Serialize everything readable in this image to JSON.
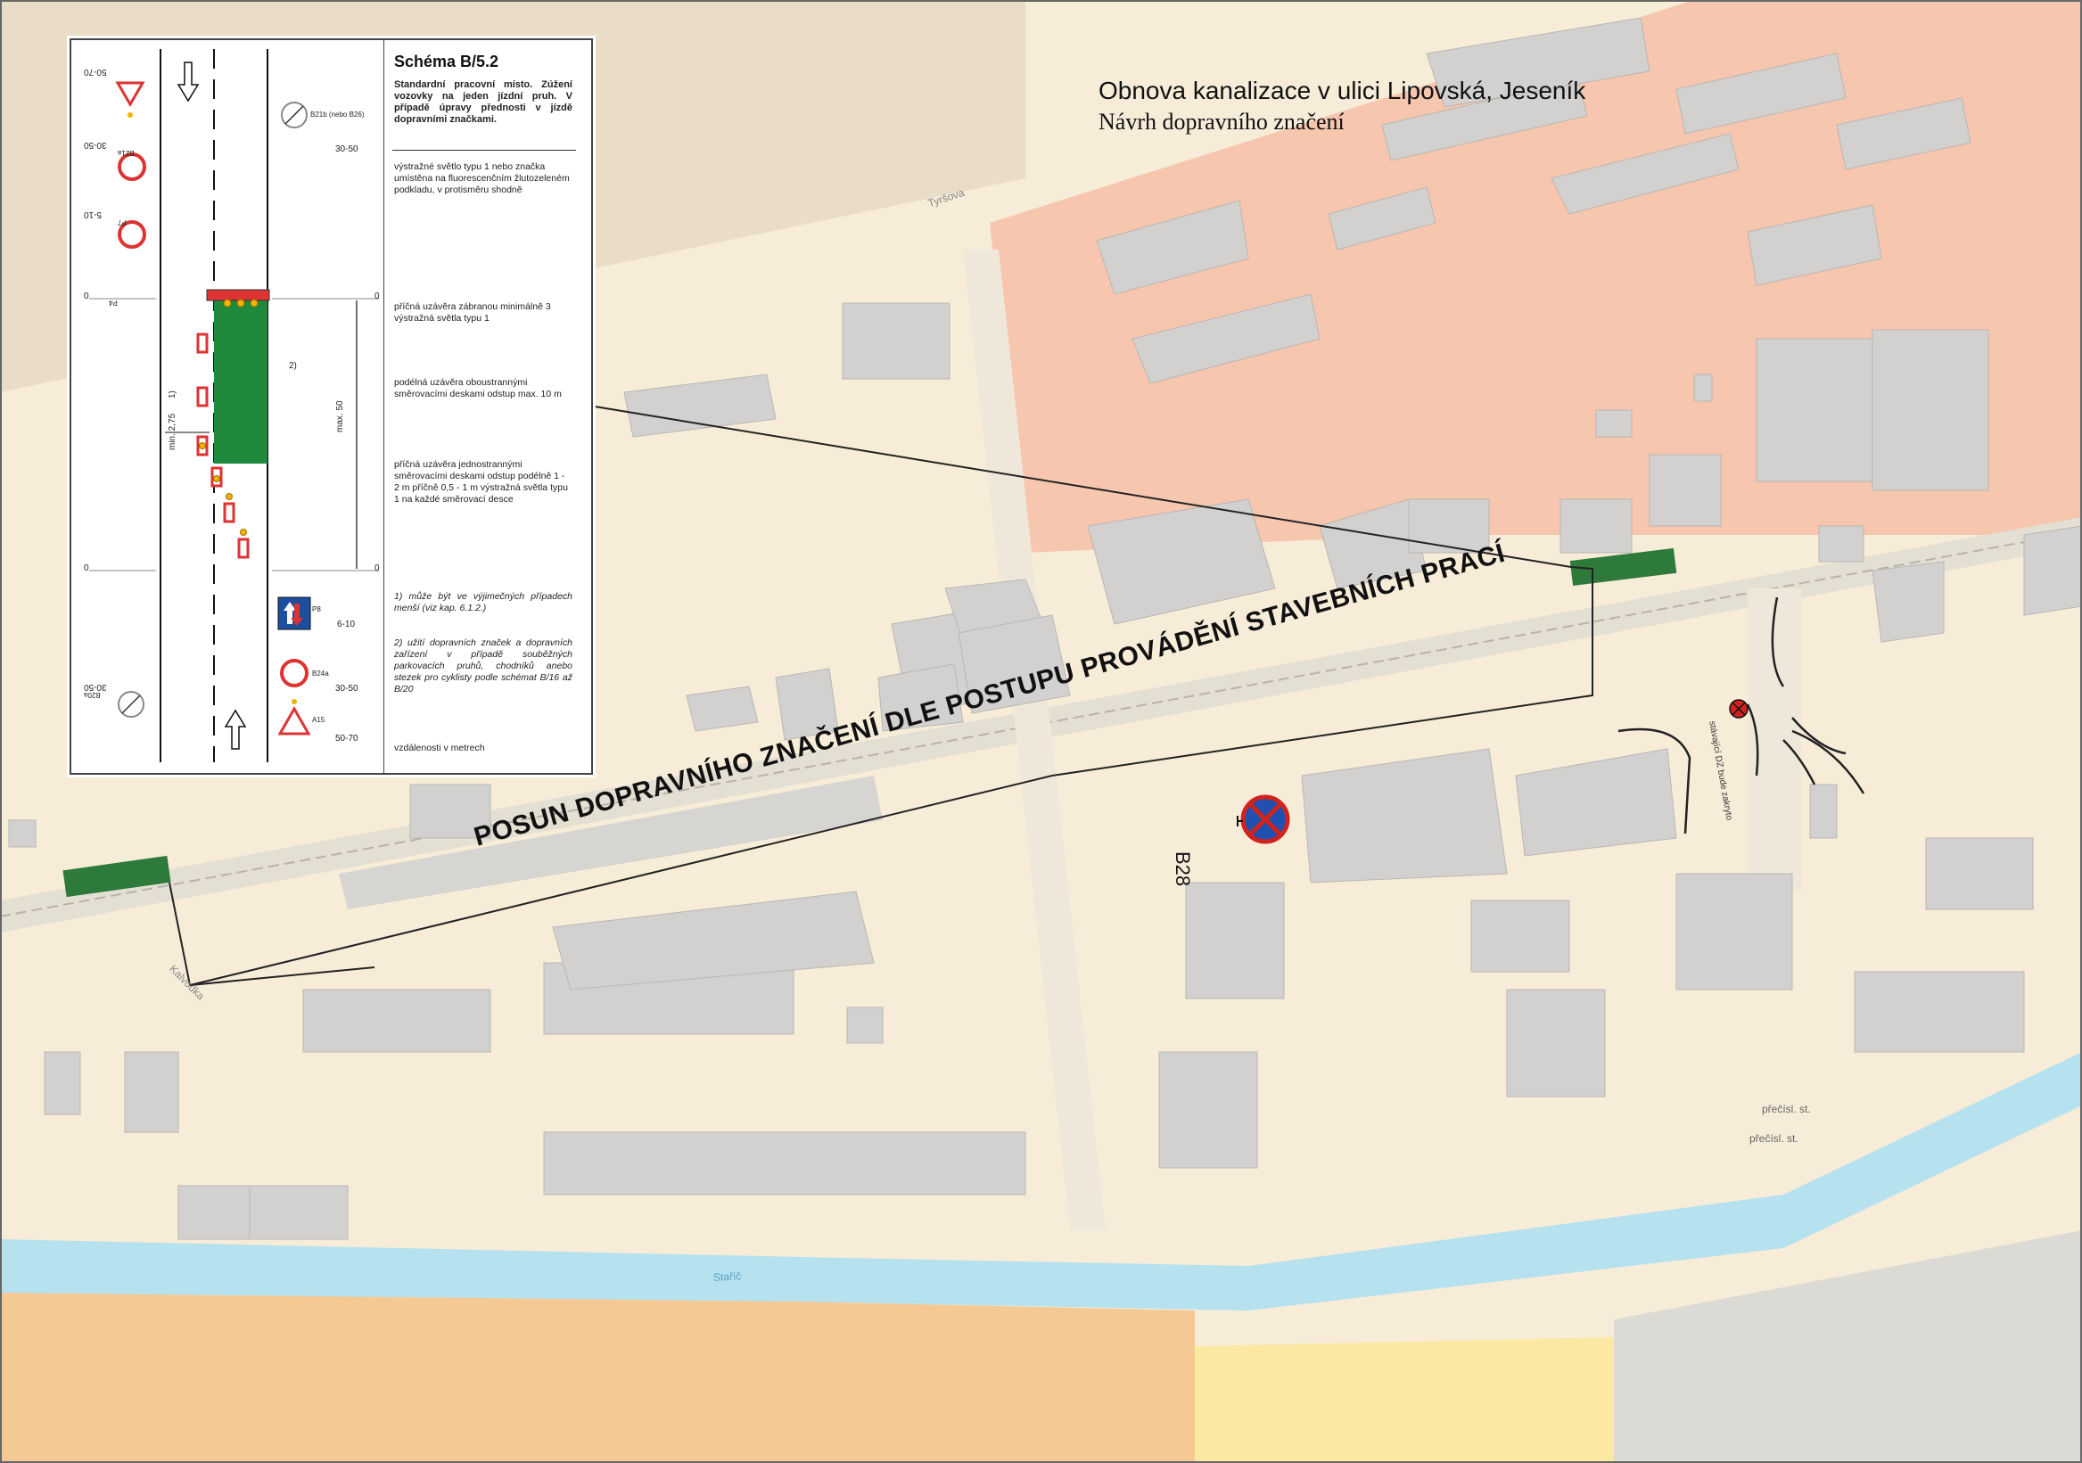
{
  "title": {
    "line1": "Obnova kanalizace v ulici Lipovská, Jeseník",
    "line2": "Návrh dopravního značení"
  },
  "schema": {
    "heading": "Schéma B/5.2",
    "subtitle": "Standardní pracovní místo. Zúžení vozovky na jeden jízdní pruh. V případě úpravy přednosti v jízdě dopravními značkami.",
    "note_light": "výstražné světlo typu 1 nebo značka umístěna na fluorescenčním žlutozeleném podkladu, v protisměru shodně",
    "note_cross_barrier": "příčná uzávěra zábranou minimálně 3 výstražná světla typu 1",
    "note_longitudinal": "podélná uzávěra oboustrannými směrovacími deskami odstup max. 10 m",
    "note_cross_single": "příčná uzávěra jednostrannými směrovacími deskami odstup podélně    1 - 2 m               příčně    0,5 - 1 m výstražná světla typu 1 na každé směrovací desce",
    "footnote1": "1) může být ve výjimečných případech menší (viz kap. 6.1.2.)",
    "footnote2": "2) užití dopravních značek a dopravních zařízení v případě souběžných parkovacích pruhů, chodníků anebo stezek pro cyklisty podle schémat B/16 až B/20",
    "units_note": "vzdálenosti v metrech",
    "sign_b21b": "B21b (nebo B26)",
    "sign_p8": "P8",
    "sign_b24a": "B24a",
    "sign_a15": "A15",
    "sign_p7": "P7",
    "sign_b21a": "B21a",
    "sign_p4": "P4",
    "sign_b20a": "B20a",
    "dist_30_50": "30-50",
    "dist_6_10": "6-10",
    "dist_50_70": "50-70",
    "dist_5_10": "5-10",
    "zero": "0",
    "min_275": "min. 2,75",
    "max_50": "max. 50",
    "footnote_ref1": "1)",
    "footnote_ref2": "2)"
  },
  "overlay": {
    "posun": "POSUN DOPRAVNÍHO ZNAČENÍ DLE POSTUPU PROVÁDĚNÍ STAVEBNÍCH PRACÍ",
    "sign_code": "B28",
    "sign_note": "stávající DZ bude zakryto"
  },
  "streets": {
    "tyrsova": "Tyršova",
    "kalvodka": "Kalvodka",
    "stazka": "Staříč"
  },
  "parcels": {
    "precisl_1": "přečísl. st.",
    "precisl_2": "přečísl. st."
  },
  "colors": {
    "industrial_area": "#f6c6ae",
    "residential_area": "#f7ecd8",
    "building": "#d2d1cf",
    "road": "#f3efe6",
    "river": "#b6e1ef",
    "work_zone": "#2e7a3b",
    "no_stopping_sign_red": "#d0231e",
    "no_stopping_sign_blue": "#2050b0"
  },
  "icons": [
    "no-stopping-sign-icon",
    "give-way-sign-icon",
    "no-overtaking-sign-icon",
    "narrowing-sign-icon",
    "priority-over-oncoming-sign-icon",
    "roadworks-sign-icon",
    "direction-arrow-icon"
  ]
}
